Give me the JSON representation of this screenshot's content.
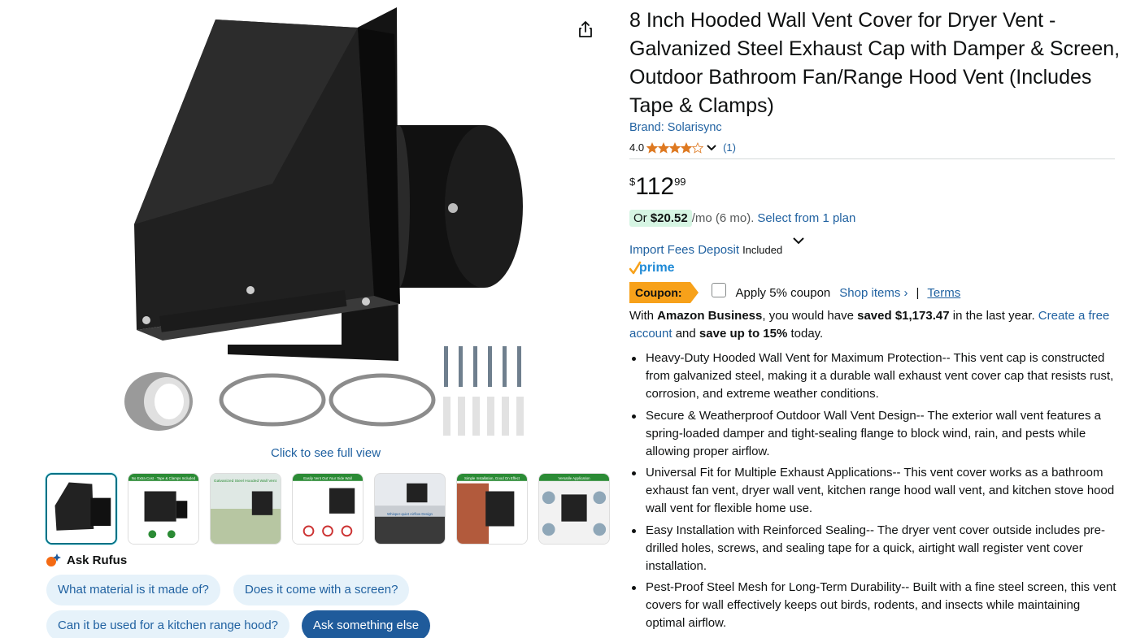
{
  "gallery": {
    "full_view_label": "Click to see full view",
    "thumbnails": [
      {
        "caption": ""
      },
      {
        "caption": "No Extra Cost · Tape & Clamps Included"
      },
      {
        "caption": "Galvanized Steel Hooded Wall Vent"
      },
      {
        "caption": "Easily Vent Out Your Side Wall"
      },
      {
        "caption": "Whisper-quiet Airflow Design"
      },
      {
        "caption": "Simple Installation, Good On Effect"
      },
      {
        "caption": "Versatile Application"
      }
    ]
  },
  "rufus": {
    "label": "Ask Rufus",
    "questions": [
      "What material is it made of?",
      "Does it come with a screen?",
      "Can it be used for a kitchen range hood?"
    ],
    "ask_button": "Ask something else"
  },
  "product": {
    "title": "8 Inch Hooded Wall Vent Cover for Dryer Vent - Galvanized Steel Exhaust Cap with Damper & Screen, Outdoor Bathroom Fan/Range Hood Vent (Includes Tape & Clamps)",
    "brand": "Brand: Solarisync",
    "rating": "4.0",
    "rating_value": 4.0,
    "rating_count": "(1)",
    "price": {
      "symbol": "$",
      "whole": "112",
      "fraction": "99"
    },
    "monthly": {
      "prefix": "Or ",
      "amount": "$20.52",
      "suffix": "/mo (6 mo).",
      "link": "Select from 1 plan"
    },
    "import_fees": {
      "link": "Import Fees Deposit",
      "status": "Included"
    },
    "prime": "prime",
    "coupon": {
      "badge": "Coupon:",
      "text": "Apply 5% coupon",
      "shop": "Shop items ›",
      "sep": "|",
      "terms": "Terms"
    },
    "business": {
      "p1": "With ",
      "b1": "Amazon Business",
      "p2": ", you would have ",
      "b2": "saved $1,173.47",
      "p3": " in the last year. ",
      "link": "Create a free account",
      "p4": " and ",
      "b3": "save up to 15%",
      "p5": " today."
    },
    "bullets": [
      "Heavy-Duty Hooded Wall Vent for Maximum Protection-- This vent cap is constructed from galvanized steel, making it a durable wall exhaust vent cover cap that resists rust, corrosion, and extreme weather conditions.",
      "Secure & Weatherproof Outdoor Wall Vent Design-- The exterior wall vent features a spring-loaded damper and tight-sealing flange to block wind, rain, and pests while allowing proper airflow.",
      "Universal Fit for Multiple Exhaust Applications-- This vent cover works as a bathroom exhaust fan vent, dryer wall vent, kitchen range hood wall vent, and kitchen stove hood wall vent for flexible home use.",
      "Easy Installation with Reinforced Sealing-- The dryer vent cover outside includes pre-drilled holes, screws, and sealing tape for a quick, airtight wall register vent cover installation.",
      "Pest-Proof Steel Mesh for Long-Term Durability-- Built with a fine steel screen, this vent covers for wall effectively keeps out birds, rodents, and insects while maintaining optimal airflow."
    ]
  },
  "colors": {
    "link": "#2162a1",
    "coupon": "#f7a11a",
    "star": "#de7921",
    "chip_bg": "#e6f2fa",
    "chip_primary": "#1f5b9b"
  },
  "icons": [
    "share-icon",
    "rufus-icon",
    "star-icon",
    "chevron-down-icon",
    "prime-check-icon"
  ]
}
